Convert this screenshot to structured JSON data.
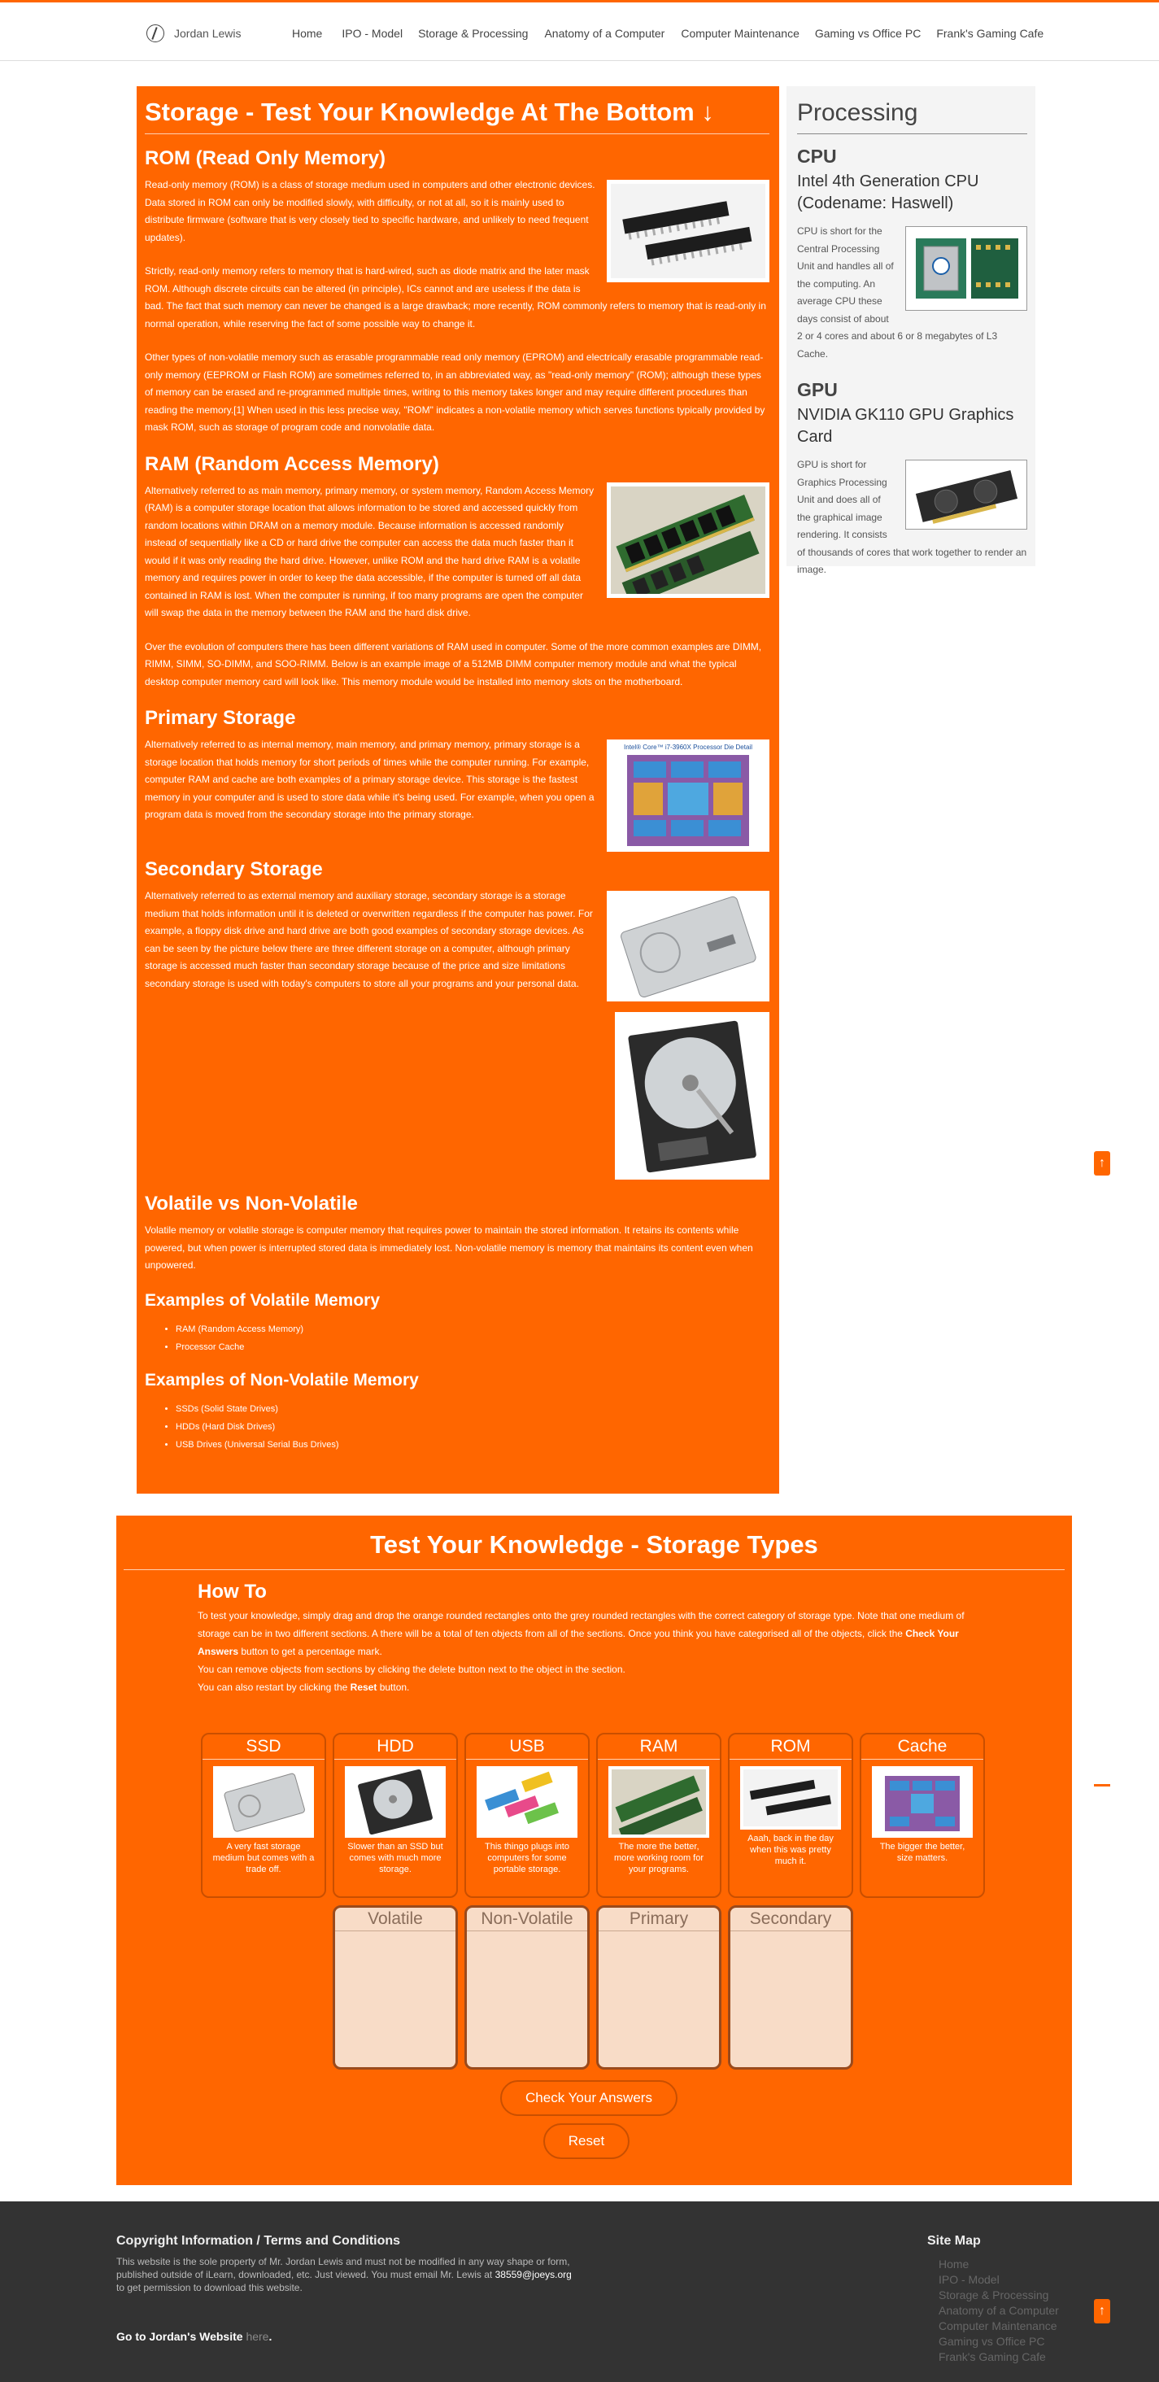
{
  "nav": {
    "brand": "Jordan Lewis",
    "links": [
      "Home",
      "IPO - Model",
      "Storage & Processing",
      "Anatomy of a Computer",
      "Computer Maintenance",
      "Gaming vs Office PC",
      "Frank's Gaming Cafe"
    ]
  },
  "colors": {
    "accent": "#ff6600",
    "footer_bg": "#333333",
    "sidebar_bg": "#f4f4f4",
    "dropzone_bg": "#f8dcc7"
  },
  "main": {
    "title": "Storage - Test Your Knowledge At The Bottom ↓",
    "rom": {
      "heading": "ROM (Read Only Memory)",
      "p1": "Read-only memory (ROM) is a class of storage medium used in computers and other electronic devices. Data stored in ROM can only be modified slowly, with difficulty, or not at all, so it is mainly used to distribute firmware (software that is very closely tied to specific hardware, and unlikely to need frequent updates).",
      "p2": "Strictly, read-only memory refers to memory that is hard-wired, such as diode matrix and the later mask ROM. Although discrete circuits can be altered (in principle), ICs cannot and are useless if the data is bad. The fact that such memory can never be changed is a large drawback; more recently, ROM commonly refers to memory that is read-only in normal operation, while reserving the fact of some possible way to change it.",
      "p3": "Other types of non-volatile memory such as erasable programmable read only memory (EPROM) and electrically erasable programmable read-only memory (EEPROM or Flash ROM) are sometimes referred to, in an abbreviated way, as \"read-only memory\" (ROM); although these types of memory can be erased and re-programmed multiple times, writing to this memory takes longer and may require different procedures than reading the memory.[1] When used in this less precise way, \"ROM\" indicates a non-volatile memory which serves functions typically provided by mask ROM, such as storage of program code and nonvolatile data."
    },
    "ram": {
      "heading": "RAM (Random Access Memory)",
      "p1": "Alternatively referred to as main memory, primary memory, or system memory, Random Access Memory (RAM) is a computer storage location that allows information to be stored and accessed quickly from random locations within DRAM on a memory module. Because information is accessed randomly instead of sequentially like a CD or hard drive the computer can access the data much faster than it would if it was only reading the hard drive. However, unlike ROM and the hard drive RAM is a volatile memory and requires power in order to keep the data accessible, if the computer is turned off all data contained in RAM is lost. When the computer is running, if too many programs are open the computer will swap the data in the memory between the RAM and the hard disk drive.",
      "p2": "Over the evolution of computers there has been different variations of RAM used in computer. Some of the more common examples are DIMM, RIMM, SIMM, SO-DIMM, and SOO-RIMM. Below is an example image of a 512MB DIMM computer memory module and what the typical desktop computer memory card will look like. This memory module would be installed into memory slots on the motherboard."
    },
    "primary": {
      "heading": "Primary Storage",
      "p1": "Alternatively referred to as internal memory, main memory, and primary memory, primary storage is a storage location that holds memory for short periods of times while the computer running. For example, computer RAM and cache are both examples of a primary storage device. This storage is the fastest memory in your computer and is used to store data while it's being used. For example, when you open a program data is moved from the secondary storage into the primary storage.",
      "img_caption": "Intel® Core™ i7-3960X Processor Die Detail"
    },
    "secondary": {
      "heading": "Secondary Storage",
      "p1": "Alternatively referred to as external memory and auxiliary storage, secondary storage is a storage medium that holds information until it is deleted or overwritten regardless if the computer has power. For example, a floppy disk drive and hard drive are both good examples of secondary storage devices. As can be seen by the picture below there are three different storage on a computer, although primary storage is accessed much faster than secondary storage because of the price and size limitations secondary storage is used with today's computers to store all your programs and your personal data."
    },
    "volatile": {
      "heading": "Volatile vs Non-Volatile",
      "p1": "Volatile memory or volatile storage is computer memory that requires power to maintain the stored information. It retains its contents while powered, but when power is interrupted stored data is immediately lost. Non-volatile memory is memory that maintains its content even when unpowered.",
      "ex_vol_heading": "Examples of Volatile Memory",
      "ex_vol": [
        "RAM (Random Access Memory)",
        "Processor Cache"
      ],
      "ex_nonvol_heading": "Examples of Non-Volatile Memory",
      "ex_nonvol": [
        "SSDs (Solid State Drives)",
        "HDDs (Hard Disk Drives)",
        "USB Drives (Universal Serial Bus Drives)"
      ]
    }
  },
  "sidebar": {
    "title": "Processing",
    "cpu": {
      "heading": "CPU",
      "subheading": "Intel 4th Generation CPU (Codename: Haswell)",
      "text": "CPU is short for the Central Processing Unit and handles all of the computing. An average CPU these days consist of about 2 or 4 cores and about 6 or 8 megabytes of L3 Cache."
    },
    "gpu": {
      "heading": "GPU",
      "subheading": "NVIDIA GK110 GPU Graphics Card",
      "text": "GPU is short for Graphics Processing Unit and does all of the graphical image rendering. It consists of thousands of cores that work together to render an image."
    }
  },
  "test": {
    "title": "Test Your Knowledge - Storage Types",
    "howto_heading": "How To",
    "howto_p1a": "To test your knowledge, simply drag and drop the orange rounded rectangles onto the grey rounded rectangles with the correct category of storage type. Note that one medium of storage can be in two different sections. A there will be a total of ten objects from all of the sections. Once you think you have categorised all of the objects, click the ",
    "howto_p1b": "Check Your Answers",
    "howto_p1c": " button to get a percentage mark.",
    "howto_p2": "You can remove objects from sections by clicking the delete button next to the object in the section.",
    "howto_p3a": "You can also restart by clicking the ",
    "howto_p3b": "Reset",
    "howto_p3c": " button.",
    "cards": [
      {
        "title": "SSD",
        "desc": "A very fast storage medium but comes with a trade off."
      },
      {
        "title": "HDD",
        "desc": "Slower than an SSD but comes with much more storage."
      },
      {
        "title": "USB",
        "desc": "This thingo plugs into computers for some portable storage."
      },
      {
        "title": "RAM",
        "desc": "The more the better, more working room for your programs."
      },
      {
        "title": "ROM",
        "desc": "Aaah, back in the day when this was pretty much it."
      },
      {
        "title": "Cache",
        "desc": "The bigger the better, size matters."
      }
    ],
    "zones": [
      "Volatile",
      "Non-Volatile",
      "Primary",
      "Secondary"
    ],
    "check_label": "Check Your Answers",
    "reset_label": "Reset"
  },
  "footer": {
    "copy_heading": "Copyright Information / Terms and Conditions",
    "copy_text": "This website is the sole property of Mr. Jordan Lewis and must not be modified in any way shape or form, published outside of iLearn, downloaded, etc. Just viewed. You must email Mr. Lewis at ",
    "email": "38559@joeys.org",
    "copy_text2": " to get permission to download this website.",
    "goto_text": "Go to Jordan's Website ",
    "goto_link": "here",
    "goto_end": ".",
    "sitemap_heading": "Site Map",
    "sitemap": [
      "Home",
      "IPO - Model",
      "Storage & Processing",
      "Anatomy of a Computer",
      "Computer Maintenance",
      "Gaming vs Office PC",
      "Frank's Gaming Cafe"
    ]
  },
  "totop_icon": "up-arrow-icon"
}
